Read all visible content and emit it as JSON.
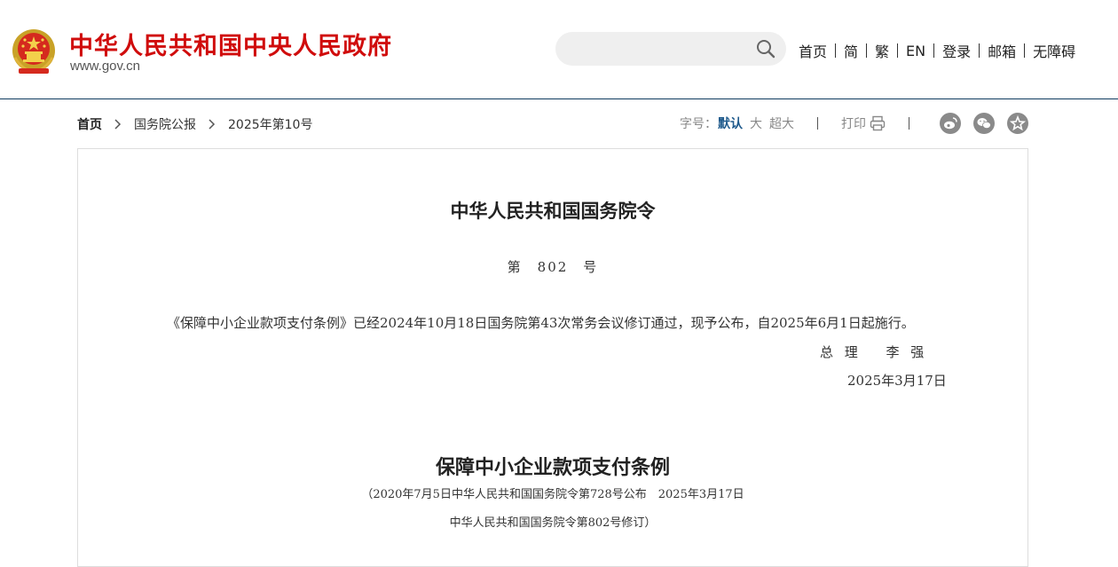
{
  "header": {
    "site_title": "中华人民共和国中央人民政府",
    "site_url": "www.gov.cn",
    "search_placeholder": "",
    "nav": [
      "首页",
      "简",
      "繁",
      "EN",
      "登录",
      "邮箱",
      "无障碍"
    ]
  },
  "breadcrumb": {
    "items": [
      "首页",
      "国务院公报",
      "2025年第10号"
    ]
  },
  "tools": {
    "font_size_label": "字号：",
    "font_default": "默认",
    "font_large": "大",
    "font_xlarge": "超大",
    "print_label": "打印"
  },
  "share": {
    "icons": [
      "weibo-icon",
      "wechat-icon",
      "favorite-icon"
    ]
  },
  "article": {
    "order_title": "中华人民共和国国务院令",
    "order_number": "第　802　号",
    "order_body": "《保障中小企业款项支付条例》已经2024年10月18日国务院第43次常务会议修订通过，现予公布，自2025年6月1日起施行。",
    "signer": "总 理　 李 强",
    "sign_date": "2025年3月17日",
    "regulation_title": "保障中小企业款项支付条例",
    "regulation_subtitle_1": "（2020年7月5日中华人民共和国国务院令第728号公布　2025年3月17日",
    "regulation_subtitle_2": "中华人民共和国国务院令第802号修订）"
  },
  "colors": {
    "brand_red": "#d00c0c",
    "accent_blue": "#1f5a8c",
    "header_rule": "#0f3a5f"
  }
}
